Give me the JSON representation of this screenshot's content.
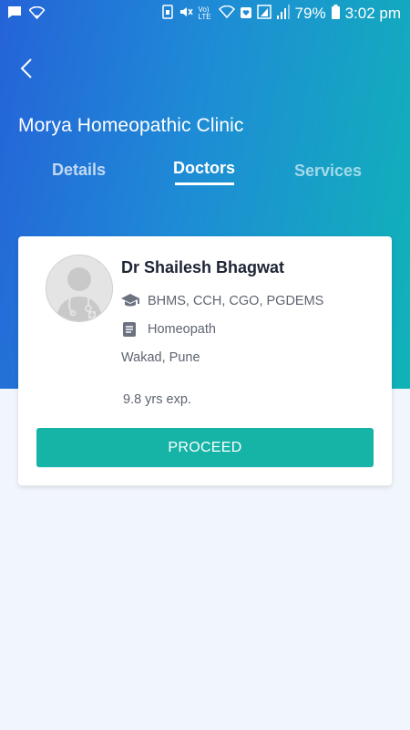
{
  "status_bar": {
    "battery_percent": "79%",
    "time": "3:02 pm",
    "network_label": "Vo) LTE"
  },
  "header": {
    "clinic_name": "Morya Homeopathic Clinic",
    "tabs": [
      {
        "label": "Details",
        "active": false
      },
      {
        "label": "Doctors",
        "active": true
      },
      {
        "label": "Services",
        "active": false
      }
    ]
  },
  "doctor_card": {
    "name": "Dr Shailesh Bhagwat",
    "qualifications": "BHMS, CCH, CGO, PGDEMS",
    "specialty": "Homeopath",
    "location": "Wakad, Pune",
    "experience": "9.8 yrs exp.",
    "proceed_label": "PROCEED"
  },
  "colors": {
    "header_gradient_start": "#2563d8",
    "header_gradient_end": "#10b3b8",
    "accent": "#16b3a7",
    "page_bg": "#f1f6fc"
  }
}
